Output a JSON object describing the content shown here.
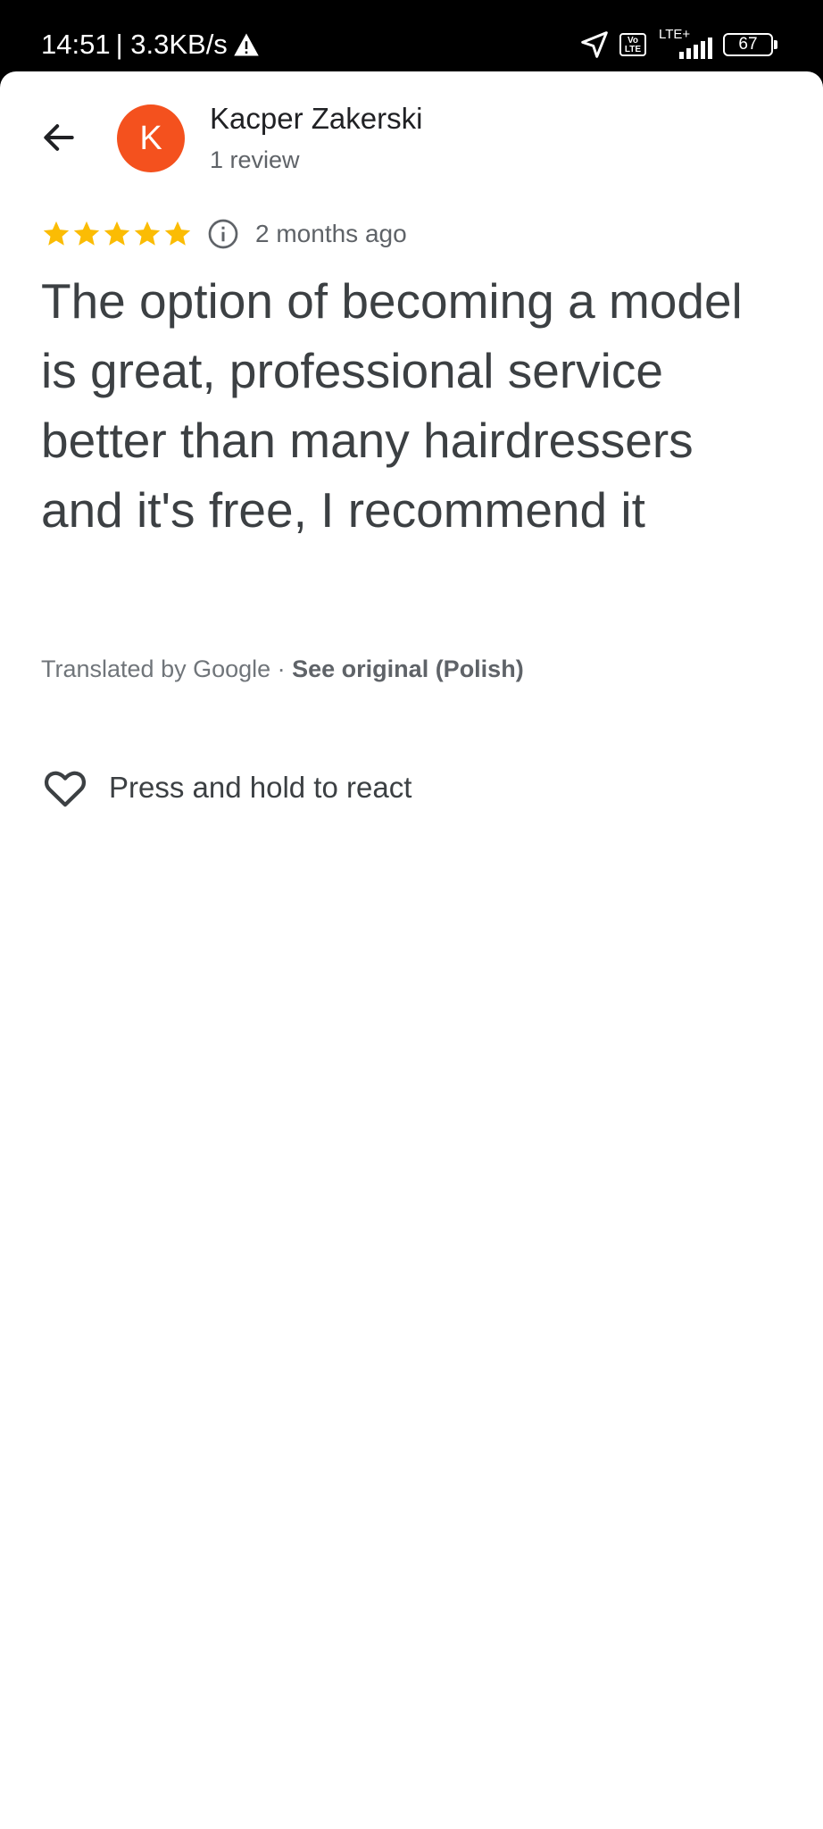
{
  "status_bar": {
    "time": "14:51",
    "speed": "| 3.3KB/s",
    "warning_icon": "warning-icon",
    "volte": "Vo LTE",
    "network": "LTE+",
    "battery": "67"
  },
  "reviewer": {
    "avatar_initial": "K",
    "avatar_color": "#f4511e",
    "name": "Kacper Zakerski",
    "review_count": "1 review"
  },
  "review": {
    "rating": 5,
    "rating_max": 5,
    "star_color": "#fbbc04",
    "date": "2 months ago",
    "text": "The option of becoming a model is great, professional service better than many hairdressers and it's free, I recommend it"
  },
  "translation": {
    "label": "Translated by Google · ",
    "link": "See original (Polish)"
  },
  "react": {
    "label": "Press and hold to react"
  }
}
